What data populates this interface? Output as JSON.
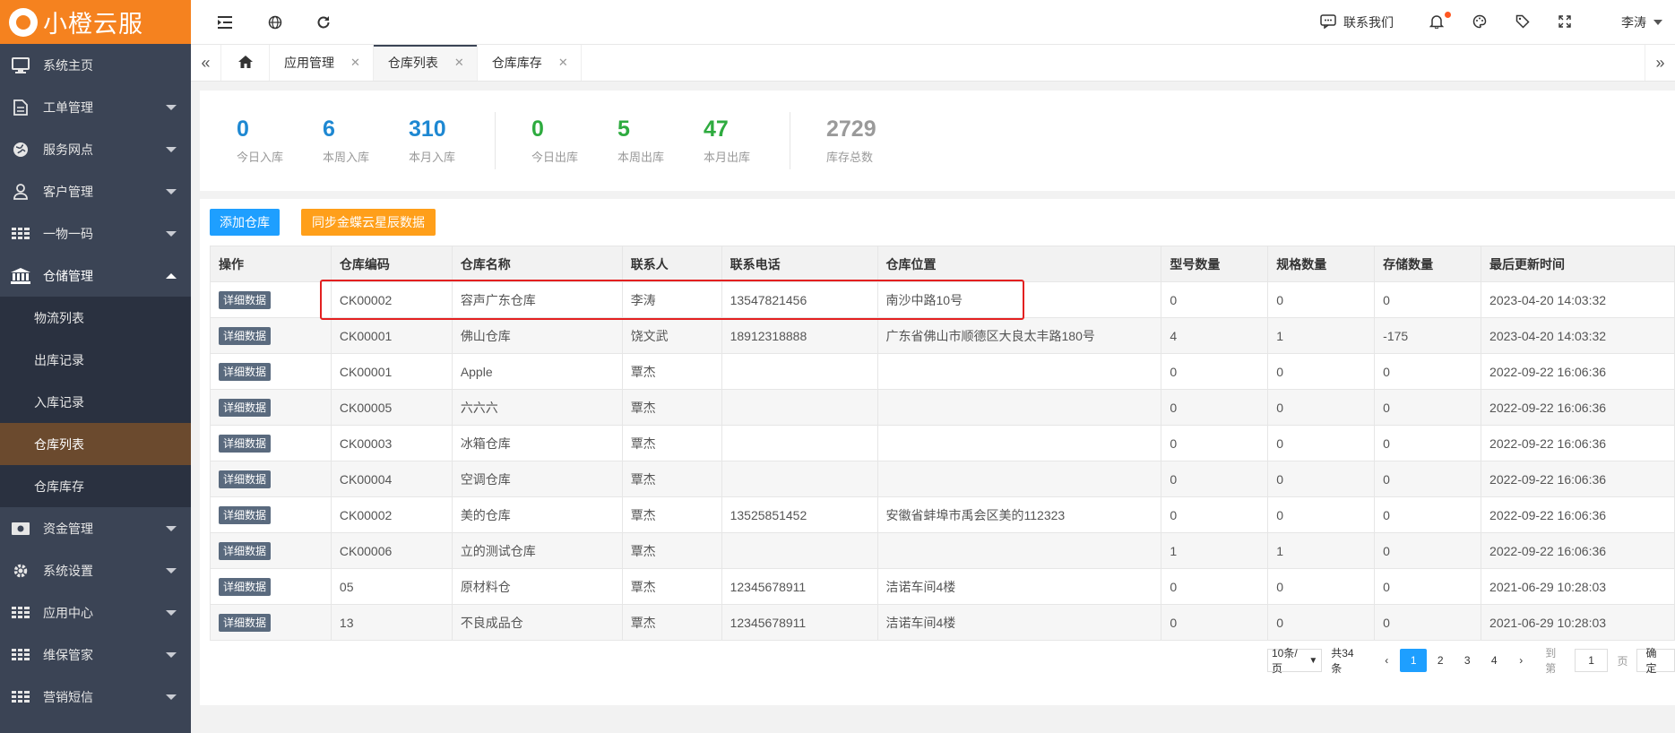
{
  "brand": {
    "name": "小橙云服"
  },
  "sidebar": {
    "items": [
      {
        "label": "系统主页"
      },
      {
        "label": "工单管理"
      },
      {
        "label": "服务网点"
      },
      {
        "label": "客户管理"
      },
      {
        "label": "一物一码"
      },
      {
        "label": "仓储管理"
      },
      {
        "label": "资金管理"
      },
      {
        "label": "系统设置"
      },
      {
        "label": "应用中心"
      },
      {
        "label": "维保管家"
      },
      {
        "label": "营销短信"
      }
    ],
    "sub_items": [
      {
        "label": "物流列表"
      },
      {
        "label": "出库记录"
      },
      {
        "label": "入库记录"
      },
      {
        "label": "仓库列表"
      },
      {
        "label": "仓库库存"
      }
    ]
  },
  "topbar": {
    "contact": "联系我们",
    "user": "李涛"
  },
  "tabs": [
    {
      "label": "应用管理"
    },
    {
      "label": "仓库列表"
    },
    {
      "label": "仓库库存"
    }
  ],
  "stats": [
    {
      "value": "0",
      "label": "今日入库",
      "color": "#1e88d2"
    },
    {
      "value": "6",
      "label": "本周入库",
      "color": "#1e88d2"
    },
    {
      "value": "310",
      "label": "本月入库",
      "color": "#1e88d2"
    },
    {
      "value": "0",
      "label": "今日出库",
      "color": "#2eab3f"
    },
    {
      "value": "5",
      "label": "本周出库",
      "color": "#2eab3f"
    },
    {
      "value": "47",
      "label": "本月出库",
      "color": "#2eab3f"
    },
    {
      "value": "2729",
      "label": "库存总数",
      "color": "#9a9a9a"
    }
  ],
  "buttons": {
    "add": "添加仓库",
    "sync": "同步金蝶云星辰数据"
  },
  "table": {
    "headers": [
      "操作",
      "仓库编码",
      "仓库名称",
      "联系人",
      "联系电话",
      "仓库位置",
      "型号数量",
      "规格数量",
      "存储数量",
      "最后更新时间"
    ],
    "action_label": "详细数据",
    "rows": [
      [
        "CK00002",
        "容声广东仓库",
        "李涛",
        "13547821456",
        "南沙中路10号",
        "0",
        "0",
        "0",
        "2023-04-20 14:03:32"
      ],
      [
        "CK00001",
        "佛山仓库",
        "饶文武",
        "18912318888",
        "广东省佛山市顺德区大良太丰路180号",
        "4",
        "1",
        "-175",
        "2023-04-20 14:03:32"
      ],
      [
        "CK00001",
        "Apple",
        "覃杰",
        "",
        "",
        "0",
        "0",
        "0",
        "2022-09-22 16:06:36"
      ],
      [
        "CK00005",
        "六六六",
        "覃杰",
        "",
        "",
        "0",
        "0",
        "0",
        "2022-09-22 16:06:36"
      ],
      [
        "CK00003",
        "冰箱仓库",
        "覃杰",
        "",
        "",
        "0",
        "0",
        "0",
        "2022-09-22 16:06:36"
      ],
      [
        "CK00004",
        "空调仓库",
        "覃杰",
        "",
        "",
        "0",
        "0",
        "0",
        "2022-09-22 16:06:36"
      ],
      [
        "CK00002",
        "美的仓库",
        "覃杰",
        "13525851452",
        "安徽省蚌埠市禹会区美的112323",
        "0",
        "0",
        "0",
        "2022-09-22 16:06:36"
      ],
      [
        "CK00006",
        "立的测试仓库",
        "覃杰",
        "",
        "",
        "1",
        "1",
        "0",
        "2022-09-22 16:06:36"
      ],
      [
        "05",
        "原材料仓",
        "覃杰",
        "12345678911",
        "洁诺车间4楼",
        "0",
        "0",
        "0",
        "2021-06-29 10:28:03"
      ],
      [
        "13",
        "不良成品仓",
        "覃杰",
        "12345678911",
        "洁诺车间4楼",
        "0",
        "0",
        "0",
        "2021-06-29 10:28:03"
      ]
    ]
  },
  "pagination": {
    "page_size": "10条/页",
    "total": "共34条",
    "pages": [
      "1",
      "2",
      "3",
      "4"
    ],
    "current": "1",
    "goto_label": "到第",
    "goto_value": "1",
    "page_unit": "页",
    "confirm": "确定"
  }
}
